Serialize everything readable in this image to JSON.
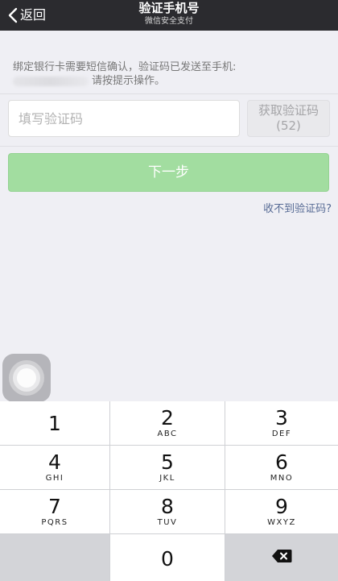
{
  "nav": {
    "back_label": "返回",
    "title": "验证手机号",
    "subtitle": "微信安全支付"
  },
  "hint": {
    "line1": "绑定银行卡需要短信确认，验证码已发送至手机:",
    "line2_suffix": "请按提示操作。"
  },
  "code_input": {
    "placeholder": "填写验证码",
    "value": ""
  },
  "get_code_button": {
    "label": "获取验证码",
    "countdown": "(52)"
  },
  "next_button": {
    "label": "下一步"
  },
  "no_code_link": {
    "label": "收不到验证码?"
  },
  "keypad": {
    "keys": [
      {
        "digit": "1",
        "letters": ""
      },
      {
        "digit": "2",
        "letters": "ABC"
      },
      {
        "digit": "3",
        "letters": "DEF"
      },
      {
        "digit": "4",
        "letters": "GHI"
      },
      {
        "digit": "5",
        "letters": "JKL"
      },
      {
        "digit": "6",
        "letters": "MNO"
      },
      {
        "digit": "7",
        "letters": "PQRS"
      },
      {
        "digit": "8",
        "letters": "TUV"
      },
      {
        "digit": "9",
        "letters": "WXYZ"
      },
      {
        "digit": "0",
        "letters": ""
      }
    ]
  },
  "icons": {
    "back": "chevron-left-icon",
    "assistive_touch": "assistive-touch-icon",
    "delete": "backspace-icon"
  },
  "colors": {
    "nav_bg": "#2b2b2f",
    "page_bg": "#efeff4",
    "primary_disabled": "#a2dda0",
    "link": "#576b95"
  }
}
